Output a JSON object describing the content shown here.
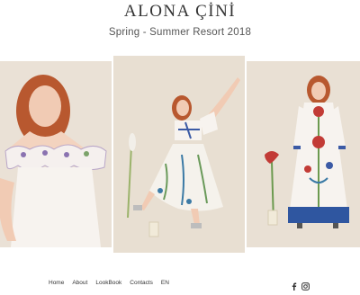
{
  "brand": {
    "name": "ALONA ÇİNİ"
  },
  "collection": {
    "title": "Spring - Summer Resort 2018"
  },
  "gallery": {
    "images": [
      {
        "alt": "model-off-shoulder-ruffle-dress"
      },
      {
        "alt": "model-embroidered-top-and-skirt"
      },
      {
        "alt": "model-floral-embroidered-gown"
      }
    ]
  },
  "footer": {
    "nav": [
      "Home",
      "About",
      "LookBook",
      "Contacts",
      "EN"
    ],
    "social": [
      "facebook-icon",
      "instagram-icon"
    ]
  },
  "colors": {
    "background": "#ffffff",
    "photo_backdrop": "#e7ddd0",
    "text": "#333333"
  }
}
